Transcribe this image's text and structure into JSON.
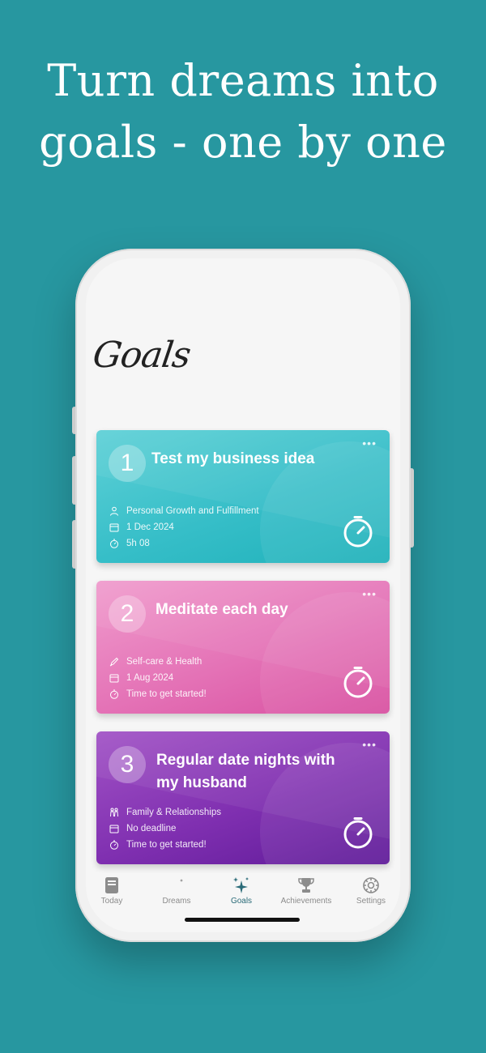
{
  "headline": {
    "line1": "Turn dreams into",
    "line2": "goals - one by one"
  },
  "screen": {
    "title": "Goals"
  },
  "goals": [
    {
      "number": "1",
      "title": "Test my business idea",
      "more": "•••",
      "category": "Personal Growth and Fulfillment",
      "date": "1 Dec 2024",
      "time": "5h 08",
      "color": "#36bec8"
    },
    {
      "number": "2",
      "title": "Meditate each day",
      "more": "•••",
      "category": "Self-care & Health",
      "date": "1 Aug 2024",
      "time": "Time to get started!",
      "color": "#e472b6"
    },
    {
      "number": "3",
      "title": "Regular date nights with my husband",
      "more": "•••",
      "category": "Family & Relationships",
      "date": "No deadline",
      "time": "Time to get started!",
      "color": "#7f2fb0"
    }
  ],
  "tabbar": {
    "items": [
      {
        "label": "Today",
        "icon": "today-icon"
      },
      {
        "label": "Dreams",
        "icon": "moon-icon"
      },
      {
        "label": "Goals",
        "icon": "sparkle-icon",
        "active": true
      },
      {
        "label": "Achievements",
        "icon": "trophy-icon"
      },
      {
        "label": "Settings",
        "icon": "gear-icon"
      }
    ]
  }
}
